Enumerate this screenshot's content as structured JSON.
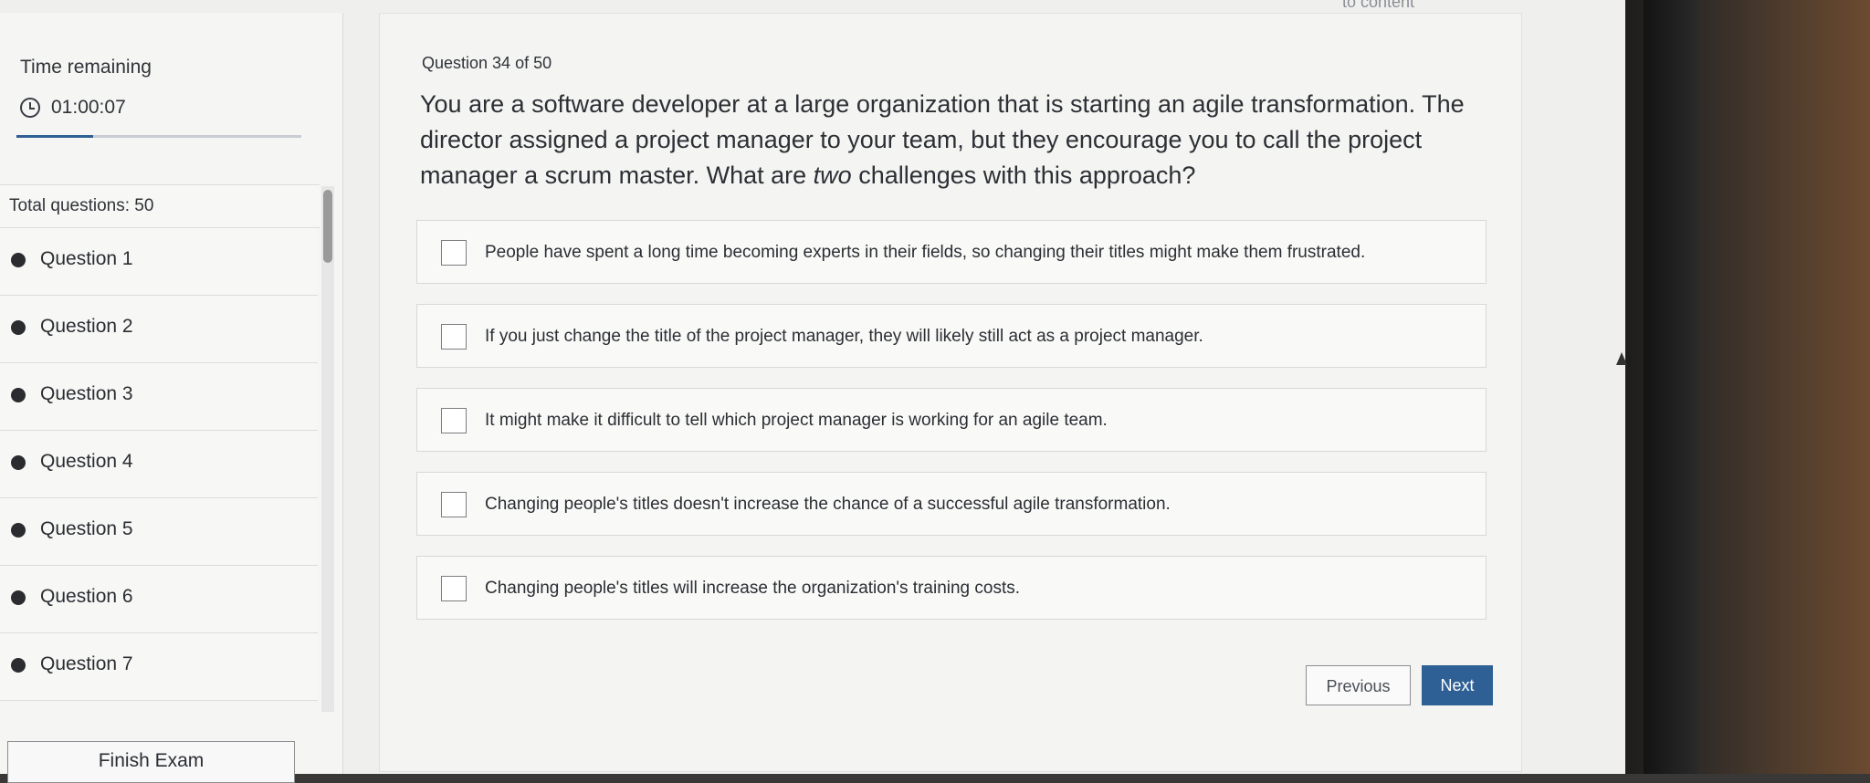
{
  "header": {
    "skip_link": "to content"
  },
  "timer": {
    "label": "Time remaining",
    "value": "01:00:07",
    "progress": 0.27
  },
  "sidebar": {
    "total_label": "Total questions: 50",
    "questions": [
      "Question 1",
      "Question 2",
      "Question 3",
      "Question 4",
      "Question 5",
      "Question 6",
      "Question 7"
    ],
    "finish_label": "Finish Exam"
  },
  "question": {
    "counter": "Question 34 of 50",
    "text_before": "You are a software developer at a large organization that is starting an agile transformation. The director assigned a project manager to your team, but they encourage you to call the project manager a scrum master. What are ",
    "text_emphasis": "two",
    "text_after": " challenges with this approach?"
  },
  "answers": [
    "People have spent a long time becoming experts in their fields, so changing their titles might make them frustrated.",
    "If you just change the title of the project manager, they will likely still act as a project manager.",
    "It might make it difficult to tell which project manager is working for an agile team.",
    "Changing people's titles doesn't increase the chance of a successful agile transformation.",
    "Changing people's titles will increase the organization's training costs."
  ],
  "navigation": {
    "previous_label": "Previous",
    "next_label": "Next"
  },
  "colors": {
    "accent": "#2e5f95",
    "background": "#efefee"
  }
}
